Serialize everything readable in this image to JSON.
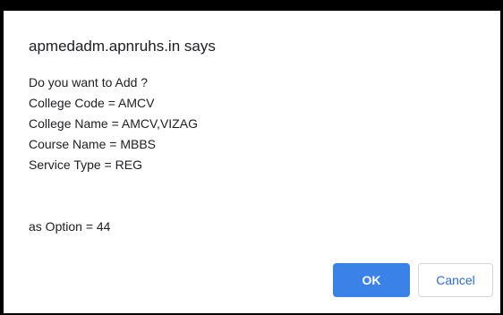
{
  "dialog": {
    "title": "apmedadm.apnruhs.in says",
    "lines": [
      "Do you want to Add ?",
      "College Code = AMCV",
      "College Name = AMCV,VIZAG",
      "Course Name = MBBS",
      "Service Type = REG"
    ],
    "option_line": "as Option = 44",
    "ok_label": "OK",
    "cancel_label": "Cancel"
  },
  "colors": {
    "ok_button": "#3b82e8",
    "cancel_text": "#2f6fd6",
    "frame": "#000000"
  }
}
